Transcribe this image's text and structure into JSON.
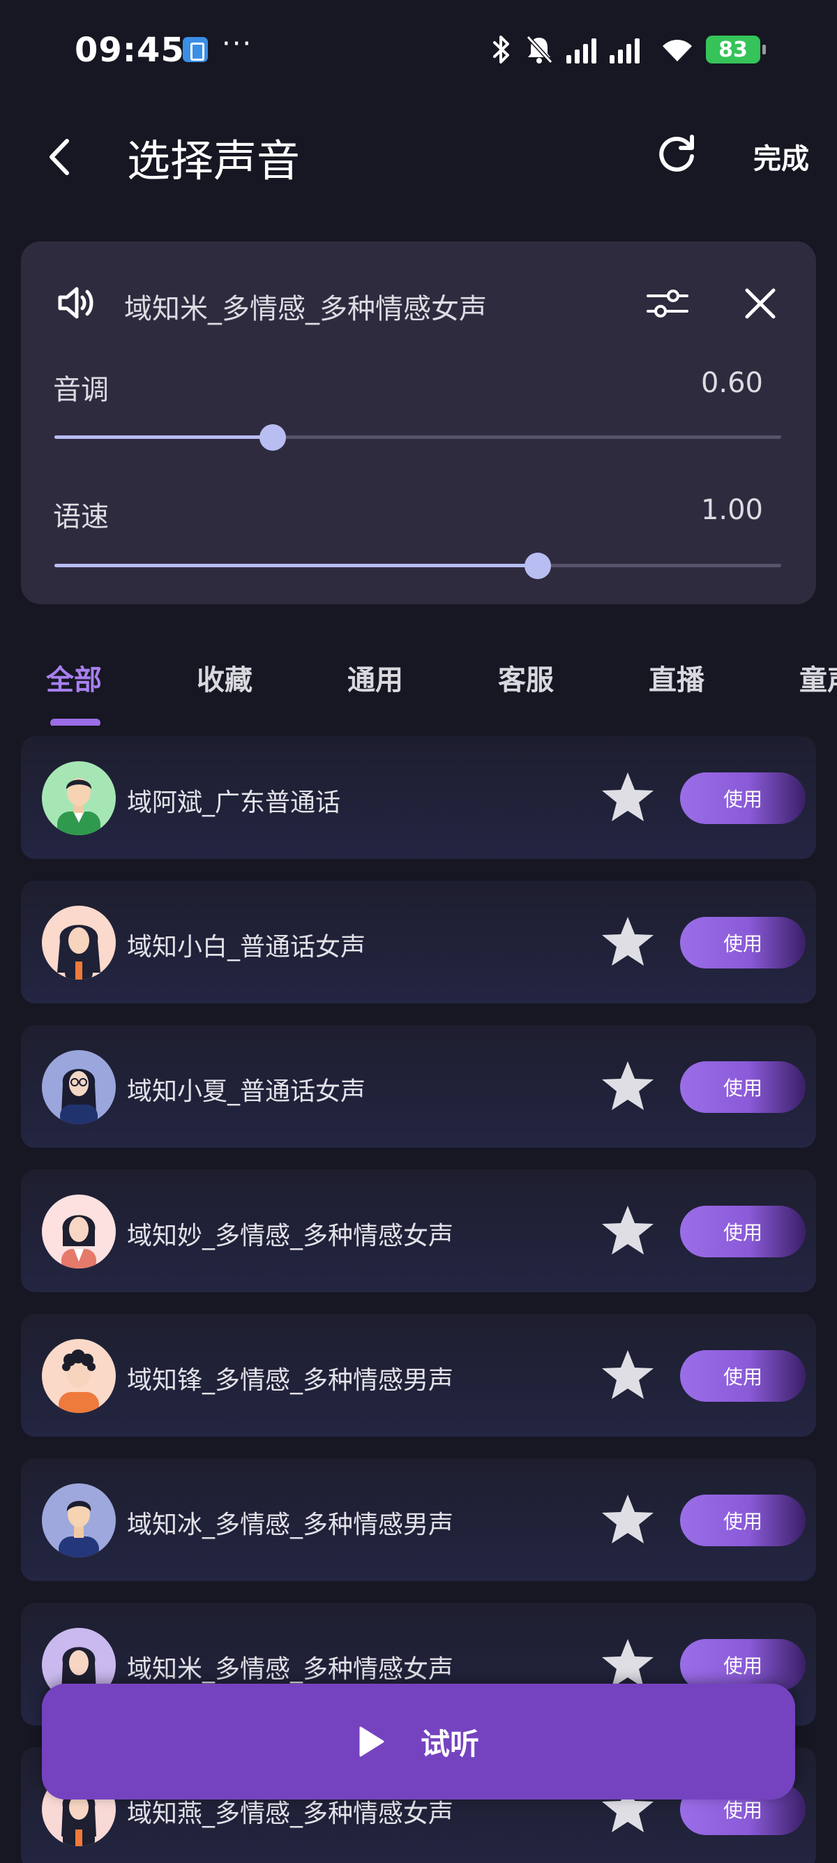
{
  "status_bar": {
    "time": "09:45",
    "more": "···",
    "battery": "83"
  },
  "header": {
    "title": "选择声音",
    "done_label": "完成"
  },
  "voice_panel": {
    "current_voice": "域知米_多情感_多种情感女声",
    "pitch": {
      "label": "音调",
      "value_text": "0.60",
      "fraction": 0.3
    },
    "speed": {
      "label": "语速",
      "value_text": "1.00",
      "fraction": 0.665
    }
  },
  "tabs": [
    {
      "label": "全部",
      "active": true
    },
    {
      "label": "收藏",
      "active": false
    },
    {
      "label": "通用",
      "active": false
    },
    {
      "label": "客服",
      "active": false
    },
    {
      "label": "直播",
      "active": false
    },
    {
      "label": "童声",
      "active": false
    }
  ],
  "voices": [
    {
      "name": "域阿斌_广东普通话",
      "avatar": "man-green-shirt",
      "use_label": "使用"
    },
    {
      "name": "域知小白_普通话女声",
      "avatar": "woman-long-hair-pink-bg",
      "use_label": "使用"
    },
    {
      "name": "域知小夏_普通话女声",
      "avatar": "woman-glasses-blue-bg",
      "use_label": "使用"
    },
    {
      "name": "域知妙_多情感_多种情感女声",
      "avatar": "woman-bob-hair-pink-bg",
      "use_label": "使用"
    },
    {
      "name": "域知锋_多情感_多种情感男声",
      "avatar": "man-curly-hair-orange",
      "use_label": "使用"
    },
    {
      "name": "域知冰_多情感_多种情感男声",
      "avatar": "man-blue-bg",
      "use_label": "使用"
    },
    {
      "name": "域知米_多情感_多种情感女声",
      "avatar": "woman-purple-bg",
      "use_label": "使用"
    },
    {
      "name": "域知燕_多情感_多种情感女声",
      "avatar": "woman-pink-bg",
      "use_label": "使用"
    }
  ],
  "audition": {
    "label": "试听"
  },
  "colors": {
    "background": "#161722",
    "panel": "#2f2b3f",
    "accent": "#9b6de6",
    "slider": "#b8bdf2",
    "audition_button": "#7543c0"
  }
}
